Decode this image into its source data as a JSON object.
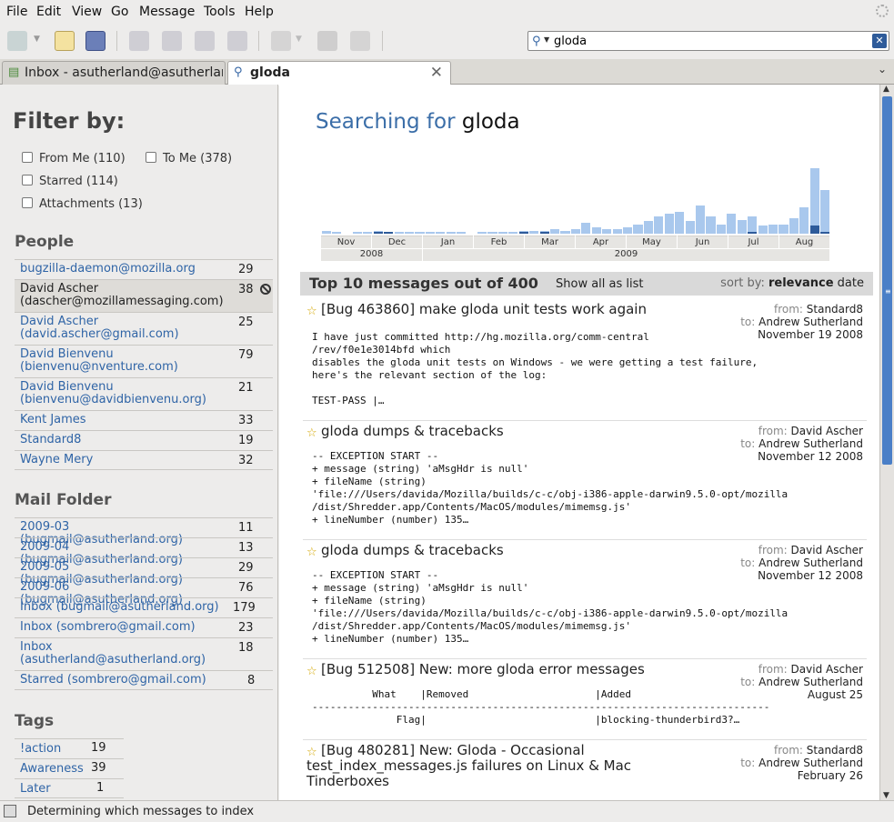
{
  "menubar": {
    "items": [
      "File",
      "Edit",
      "View",
      "Go",
      "Message",
      "Tools",
      "Help"
    ]
  },
  "toolbar": {
    "buttons": [
      "get-mail-icon",
      "write-icon",
      "address-book-icon",
      "reply-icon",
      "reply-all-icon",
      "forward-icon",
      "archive-icon",
      "tag-icon",
      "delete-icon",
      "junk-icon"
    ]
  },
  "search": {
    "value": "gloda",
    "icon": "search-icon"
  },
  "tabs": [
    {
      "label": "Inbox - asutherland@asutherlan...",
      "icon": "inbox-icon"
    },
    {
      "label": "gloda",
      "icon": "search-icon",
      "close": "✕"
    }
  ],
  "sidebar": {
    "title": "Filter by:",
    "filters": [
      {
        "label": "From Me (110)"
      },
      {
        "label": "To Me (378)"
      },
      {
        "label": "Starred (114)"
      },
      {
        "label": "Attachments (13)"
      }
    ],
    "people_title": "People",
    "people": [
      {
        "label": "bugzilla-daemon@mozilla.org",
        "count": "29"
      },
      {
        "label": "David Ascher (dascher@mozillamessaging.com)",
        "count": "38"
      },
      {
        "label": "David Ascher (david.ascher@gmail.com)",
        "count": "25"
      },
      {
        "label": "David Bienvenu (bienvenu@nventure.com)",
        "count": "79"
      },
      {
        "label": "David Bienvenu (bienvenu@davidbienvenu.org)",
        "count": "21"
      },
      {
        "label": "Kent James",
        "count": "33"
      },
      {
        "label": "Standard8",
        "count": "19"
      },
      {
        "label": "Wayne Mery",
        "count": "32"
      }
    ],
    "folder_title": "Mail Folder",
    "folders": [
      {
        "label": "2009-03 (bugmail@asutherland.org)",
        "count": "11"
      },
      {
        "label": "2009-04 (bugmail@asutherland.org)",
        "count": "13"
      },
      {
        "label": "2009-05 (bugmail@asutherland.org)",
        "count": "29"
      },
      {
        "label": "2009-06 (bugmail@asutherland.org)",
        "count": "76"
      },
      {
        "label": "Inbox (bugmail@asutherland.org)",
        "count": "179"
      },
      {
        "label": "Inbox (sombrero@gmail.com)",
        "count": "23"
      },
      {
        "label": "Inbox (asutherland@asutherland.org)",
        "count": "18"
      },
      {
        "label": "Starred (sombrero@gmail.com)",
        "count": "8"
      }
    ],
    "tags_title": "Tags",
    "tags": [
      {
        "label": "!action",
        "count": "19"
      },
      {
        "label": "Awareness",
        "count": "39"
      },
      {
        "label": "Later",
        "count": "1"
      }
    ]
  },
  "main": {
    "heading_prefix": "Searching for",
    "heading_query": "gloda",
    "top_label": "Top 10 messages out of 400",
    "show_all": "Show all as list",
    "sort_label": "sort by:",
    "sort_relevance": "relevance",
    "sort_date": "date",
    "messages": [
      {
        "subject": "[Bug 463860] make gloda unit tests work again",
        "from_label": "from:",
        "from": "Standard8",
        "to_label": "to:",
        "to": "Andrew Sutherland",
        "date": "November 19 2008",
        "body": "I have just committed http://hg.mozilla.org/comm-central\n/rev/f0e1e3014bfd which\ndisables the gloda unit tests on Windows - we were getting a test failure,\nhere's the relevant section of the log:\n\nTEST-PASS |…"
      },
      {
        "subject": "gloda dumps & tracebacks",
        "from_label": "from:",
        "from": "David Ascher",
        "to_label": "to:",
        "to": "Andrew Sutherland",
        "date": "November 12 2008",
        "body": "-- EXCEPTION START --\n+ message (string) 'aMsgHdr is null'\n+ fileName (string)\n'file:///Users/davida/Mozilla/builds/c-c/obj-i386-apple-darwin9.5.0-opt/mozilla\n/dist/Shredder.app/Contents/MacOS/modules/mimemsg.js'\n+ lineNumber (number) 135…"
      },
      {
        "subject": "gloda dumps & tracebacks",
        "from_label": "from:",
        "from": "David Ascher",
        "to_label": "to:",
        "to": "Andrew Sutherland",
        "date": "November 12 2008",
        "body": "-- EXCEPTION START --\n+ message (string) 'aMsgHdr is null'\n+ fileName (string)\n'file:///Users/davida/Mozilla/builds/c-c/obj-i386-apple-darwin9.5.0-opt/mozilla\n/dist/Shredder.app/Contents/MacOS/modules/mimemsg.js'\n+ lineNumber (number) 135…"
      },
      {
        "subject": "[Bug 512508] New: more gloda error messages",
        "from_label": "from:",
        "from": "David Ascher",
        "to_label": "to:",
        "to": "Andrew Sutherland",
        "date": "August 25",
        "body": "          What    |Removed                     |Added\n----------------------------------------------------------------------------\n              Flag|                            |blocking-thunderbird3?…"
      },
      {
        "subject": "[Bug 480281] New: Gloda - Occasional test_index_messages.js failures on Linux & Mac Tinderboxes",
        "from_label": "from:",
        "from": "Standard8",
        "to_label": "to:",
        "to": "Andrew Sutherland",
        "date": "February 26",
        "body": ""
      }
    ]
  },
  "chart_data": {
    "type": "bar",
    "title": "",
    "month_labels": [
      "Nov",
      "Dec",
      "Jan",
      "Feb",
      "Mar",
      "Apr",
      "May",
      "Jun",
      "Jul",
      "Aug"
    ],
    "year_labels": [
      "2008",
      "2009"
    ],
    "series": [
      {
        "values": [
          2,
          1,
          0,
          1,
          1,
          2,
          1,
          1,
          1,
          1,
          1,
          1,
          1,
          1,
          0,
          1,
          1,
          1,
          1,
          2,
          2,
          2,
          3,
          2,
          3,
          7,
          4,
          3,
          3,
          4,
          6,
          8,
          11,
          13,
          14,
          8,
          18,
          11,
          6,
          13,
          9,
          11,
          5,
          6,
          6,
          10,
          17,
          42,
          28
        ]
      },
      {
        "values": [
          0,
          0,
          0,
          0,
          0,
          1,
          1,
          0,
          0,
          0,
          0,
          0,
          0,
          0,
          0,
          0,
          0,
          0,
          0,
          1,
          0,
          1,
          0,
          0,
          0,
          0,
          0,
          0,
          0,
          0,
          0,
          0,
          0,
          0,
          0,
          0,
          0,
          0,
          0,
          0,
          0,
          1,
          0,
          0,
          0,
          0,
          0,
          5,
          1
        ]
      }
    ],
    "ylim": [
      0,
      42
    ],
    "colors": {
      "all": "#a9c8ed",
      "matching": "#2e5b9a"
    }
  },
  "status": {
    "text": "Determining which messages to index"
  }
}
